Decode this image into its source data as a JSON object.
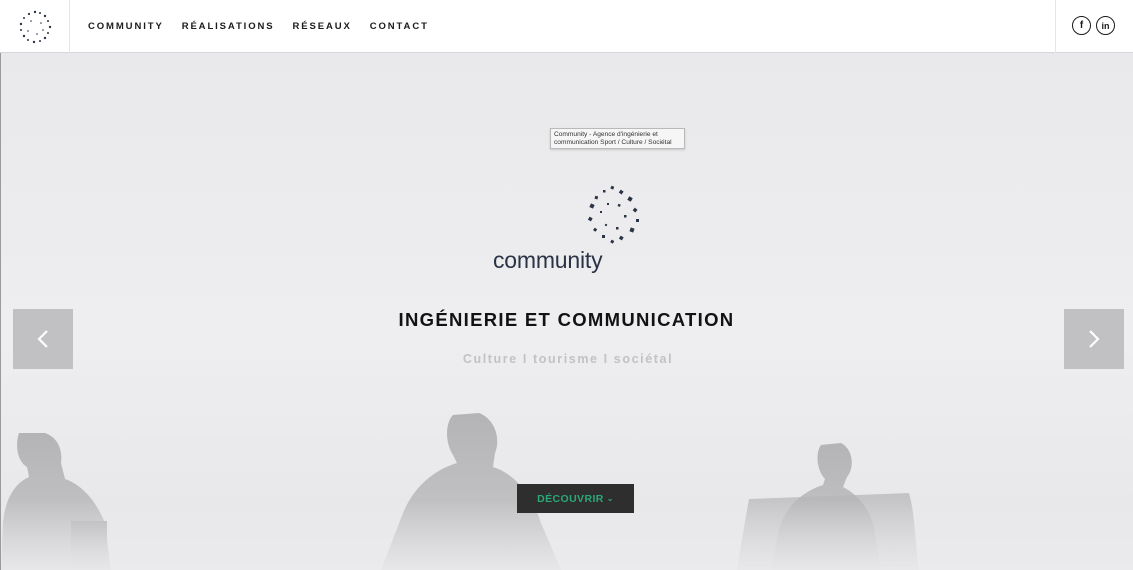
{
  "header": {
    "nav": [
      "COMMUNITY",
      "RÉALISATIONS",
      "RÉSEAUX",
      "CONTACT"
    ],
    "social": [
      {
        "icon": "facebook-icon",
        "label": "f"
      },
      {
        "icon": "linkedin-icon",
        "label": "in"
      }
    ]
  },
  "hero": {
    "tooltip_line1": "Community - Agence d'ingénierie et",
    "tooltip_line2": "communication Sport / Culture / Sociétal",
    "brand_name": "community",
    "headline": "INGÉNIERIE ET COMMUNICATION",
    "subline": "Culture I tourisme I sociétal",
    "cta_label": "DÉCOUVRIR",
    "cta_caret": "⌄",
    "prev_icon": "chevron-left-icon",
    "next_icon": "chevron-right-icon"
  },
  "colors": {
    "accent": "#2aa877",
    "brand_navy": "#2b3446",
    "cta_bg": "#2e2e2e",
    "arrow_bg": "#bfbfc2"
  }
}
